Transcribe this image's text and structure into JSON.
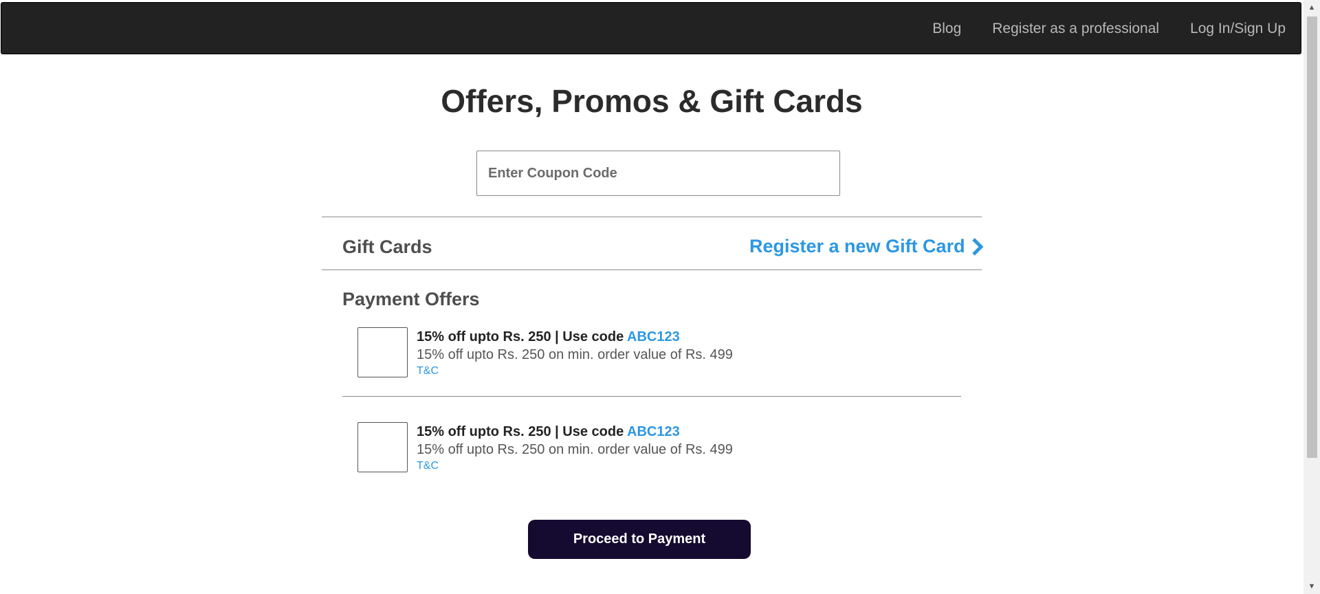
{
  "nav": {
    "items": [
      "Blog",
      "Register as a professional",
      "Log In/Sign Up"
    ]
  },
  "page": {
    "title": "Offers, Promos & Gift Cards"
  },
  "coupon": {
    "placeholder": "Enter Coupon Code",
    "value": ""
  },
  "gift_cards": {
    "heading": "Gift Cards",
    "register_link": "Register a new Gift Card",
    "register_icon": "chevron-right-icon"
  },
  "payment_offers": {
    "heading": "Payment Offers",
    "items": [
      {
        "title": "15% off upto Rs. 250 | Use code ",
        "code": "ABC123",
        "description": "15% off upto Rs. 250 on min. order value of Rs. 499",
        "tc": "T&C",
        "checked": false
      },
      {
        "title": "15% off upto Rs. 250 | Use code ",
        "code": "ABC123",
        "description": "15% off upto Rs. 250 on min. order value of Rs. 499",
        "tc": "T&C",
        "checked": false
      }
    ]
  },
  "actions": {
    "proceed": "Proceed to Payment"
  },
  "colors": {
    "navbar": "#222222",
    "link": "#2b97e3",
    "button": "#150a30"
  }
}
